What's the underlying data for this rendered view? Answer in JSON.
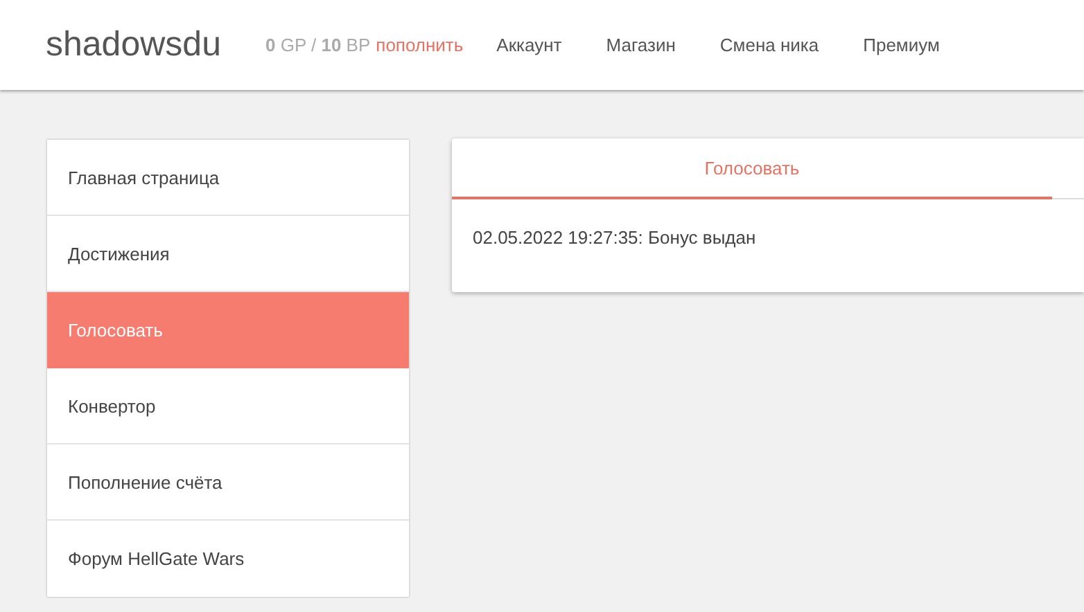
{
  "header": {
    "logo": "shadowsdu",
    "balance": "**0** GP / **10** BP",
    "topup_link": "пополнить",
    "nav": [
      "Аккаунт",
      "Магазин",
      "Смена ника",
      "Премиум"
    ]
  },
  "sidebar": {
    "items": [
      {
        "label": "Главная страница",
        "selected": false
      },
      {
        "label": "Достижения",
        "selected": false
      },
      {
        "label": "Голосовать",
        "selected": true
      },
      {
        "label": "Конвертор",
        "selected": false
      },
      {
        "label": "Пополнение счёта",
        "selected": false
      },
      {
        "label": "Форум HellGate Wars",
        "selected": false
      }
    ]
  },
  "panel": {
    "tabs": [
      {
        "label": "Голосовать",
        "selected": true
      }
    ],
    "message": "02.05.2022 19:27:35: Бонус выдан"
  }
}
